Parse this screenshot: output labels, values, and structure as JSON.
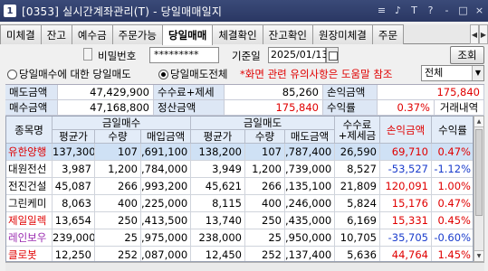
{
  "window": {
    "icon": "1",
    "title": "[0353] 실시간계좌관리(T) - 당일매매일지",
    "controls": [
      "≡",
      "♪",
      "T",
      "?",
      "-",
      "□",
      "×"
    ]
  },
  "tabs": [
    "미체결",
    "잔고",
    "예수금",
    "주문가능",
    "당일매매",
    "체결확인",
    "잔고확인",
    "원장미체결",
    "주문"
  ],
  "active_tab": 4,
  "form": {
    "password_label": "비밀번호",
    "password_value": "*********",
    "date_label": "기준일",
    "date_value": "2025/01/13",
    "query_button": "조회",
    "radio1_label": "당일매수에 대한 당일매도",
    "radio2_label": "당일매도전체",
    "notice": "*화면 관련 유의사항은 도움말 참조",
    "select_value": "전체"
  },
  "summary": {
    "sell_amount_label": "매도금액",
    "sell_amount": "47,429,900",
    "fee_tax_label": "수수료+제세금",
    "fee_tax": "85,260",
    "pnl_label": "손익금액",
    "pnl": "175,840",
    "buy_amount_label": "매수금액",
    "buy_amount": "47,168,800",
    "settle_label": "정산금액",
    "settle": "175,840",
    "return_label": "수익률",
    "return": "0.37%",
    "history_label": "거래내역"
  },
  "table": {
    "headers": {
      "name": "종목명",
      "buy_group": "금일매수",
      "sell_group": "금일매도",
      "fee_tax": "수수료\n+제세금",
      "pnl": "손익금액",
      "return": "수익률",
      "buy_avg": "평균가",
      "buy_qty": "수량",
      "buy_amt": "매입금액",
      "sell_avg": "평균가",
      "sell_qty": "수량",
      "sell_amt": "매도금액"
    },
    "rows": [
      {
        "name": "유한양행",
        "buy_avg": "137,300",
        "buy_qty": "107",
        "buy_amt": ",691,100",
        "sell_avg": "138,200",
        "sell_qty": "107",
        "sell_amt": ",787,400",
        "fee": "26,590",
        "pnl": "69,710",
        "ret": "0.47%",
        "sign": "pos",
        "name_color": "red"
      },
      {
        "name": "대원전선",
        "buy_avg": "3,987",
        "buy_qty": "1,200",
        "buy_amt": ",784,000",
        "sell_avg": "3,949",
        "sell_qty": "1,200",
        "sell_amt": ",739,000",
        "fee": "8,527",
        "pnl": "-53,527",
        "ret": "-1.12%",
        "sign": "neg",
        "name_color": "black"
      },
      {
        "name": "전진건설",
        "buy_avg": "45,087",
        "buy_qty": "266",
        "buy_amt": ",993,200",
        "sell_avg": "45,621",
        "sell_qty": "266",
        "sell_amt": ",135,100",
        "fee": "21,809",
        "pnl": "120,091",
        "ret": "1.00%",
        "sign": "pos",
        "name_color": "black"
      },
      {
        "name": "그린케미",
        "buy_avg": "8,063",
        "buy_qty": "400",
        "buy_amt": ",225,000",
        "sell_avg": "8,115",
        "sell_qty": "400",
        "sell_amt": ",246,000",
        "fee": "5,824",
        "pnl": "15,176",
        "ret": "0.47%",
        "sign": "pos",
        "name_color": "black"
      },
      {
        "name": "제일일렉",
        "buy_avg": "13,654",
        "buy_qty": "250",
        "buy_amt": ",413,500",
        "sell_avg": "13,740",
        "sell_qty": "250",
        "sell_amt": ",435,000",
        "fee": "6,169",
        "pnl": "15,331",
        "ret": "0.45%",
        "sign": "pos",
        "name_color": "red"
      },
      {
        "name": "레인보우",
        "buy_avg": "239,000",
        "buy_qty": "25",
        "buy_amt": ",975,000",
        "sell_avg": "238,000",
        "sell_qty": "25",
        "sell_amt": ",950,000",
        "fee": "10,705",
        "pnl": "-35,705",
        "ret": "-0.60%",
        "sign": "neg",
        "name_color": "purple"
      },
      {
        "name": "클로봇",
        "buy_avg": "12,250",
        "buy_qty": "252",
        "buy_amt": ",087,000",
        "sell_avg": "12,450",
        "sell_qty": "252",
        "sell_amt": ",137,400",
        "fee": "5,636",
        "pnl": "44,764",
        "ret": "1.45%",
        "sign": "pos",
        "name_color": "red"
      }
    ]
  },
  "colors": {
    "title_bar": "#2a3763",
    "positive": "#e00000",
    "negative": "#1a3ccc",
    "header_bg": "#e3ecf8",
    "selected_row": "#cfe1f5"
  }
}
